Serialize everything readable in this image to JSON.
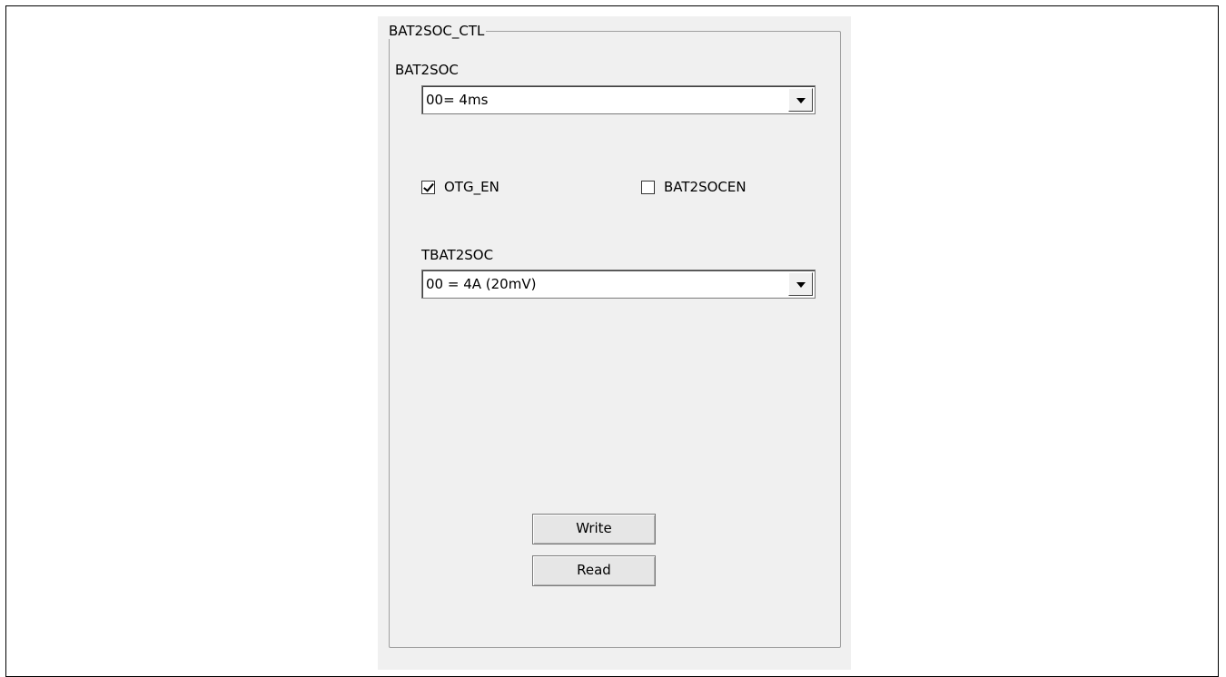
{
  "group": {
    "title": "BAT2SOC_CTL"
  },
  "bat2soc": {
    "label": "BAT2SOC",
    "selected": "00= 4ms"
  },
  "checkboxes": {
    "otg_en": {
      "label": "OTG_EN",
      "checked": true
    },
    "bat2socen": {
      "label": "BAT2SOCEN",
      "checked": false
    }
  },
  "tbat2soc": {
    "label": "TBAT2SOC",
    "selected": "00 = 4A (20mV)"
  },
  "buttons": {
    "write": "Write",
    "read": "Read"
  },
  "icons": {
    "dropdown": "chevron-down-icon",
    "checkmark": "checkmark-icon"
  }
}
